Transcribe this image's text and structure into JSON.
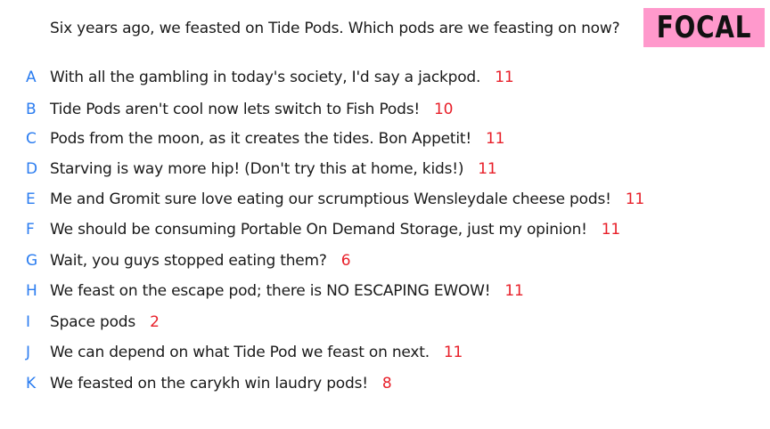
{
  "question": "Six years ago, we feasted on Tide Pods. Which pods are we feasting on now?",
  "badge": {
    "label": "FOCAL",
    "color": "#ff99cc"
  },
  "colors": {
    "letter": "#2a7cf0",
    "count": "#e8202a"
  },
  "responses": [
    {
      "letter": "A",
      "text": "With all the gambling in today's society, I'd say a jackpod.",
      "count": "11"
    },
    {
      "letter": "B",
      "text": "Tide Pods aren't cool now lets switch to Fish Pods!",
      "count": "10"
    },
    {
      "letter": "C",
      "text": "Pods from the moon, as it creates the tides. Bon Appetit!",
      "count": "11"
    },
    {
      "letter": "D",
      "text": "Starving is way more hip! (Don't try this at home, kids!)",
      "count": "11"
    },
    {
      "letter": "E",
      "text": "Me and Gromit sure love eating our scrumptious Wensleydale cheese pods!",
      "count": "11"
    },
    {
      "letter": "F",
      "text": "We should be consuming Portable On Demand Storage, just my opinion!",
      "count": "11"
    },
    {
      "letter": "G",
      "text": "Wait, you guys stopped eating them?",
      "count": "6"
    },
    {
      "letter": "H",
      "text": "We feast on the escape pod; there is NO ESCAPING EWOW!",
      "count": "11"
    },
    {
      "letter": "I",
      "text": "Space pods",
      "count": "2"
    },
    {
      "letter": "J",
      "text": "We can depend on what Tide Pod we feast on next.",
      "count": "11"
    },
    {
      "letter": "K",
      "text": "We feasted on the carykh win laudry pods!",
      "count": "8"
    }
  ]
}
